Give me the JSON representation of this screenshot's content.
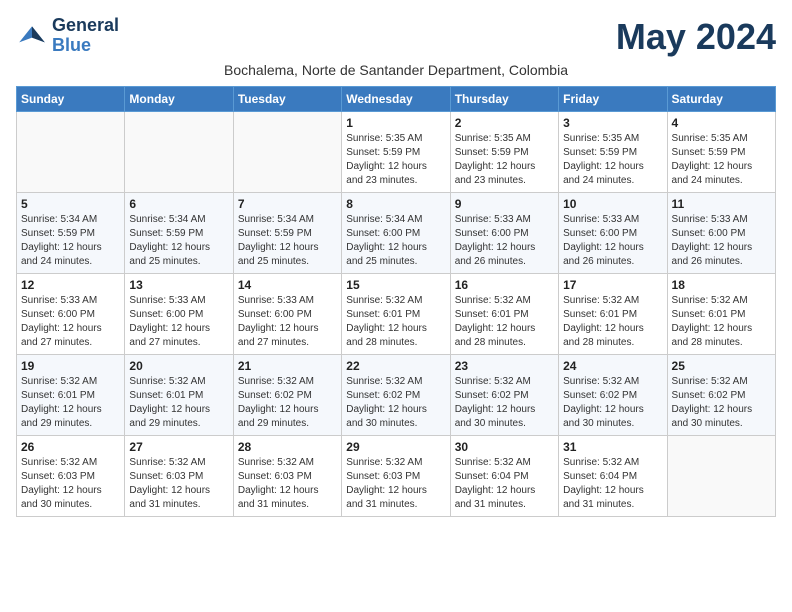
{
  "logo": {
    "line1": "General",
    "line2": "Blue"
  },
  "title": "May 2024",
  "subtitle": "Bochalema, Norte de Santander Department, Colombia",
  "days_header": [
    "Sunday",
    "Monday",
    "Tuesday",
    "Wednesday",
    "Thursday",
    "Friday",
    "Saturday"
  ],
  "weeks": [
    [
      {
        "day": "",
        "info": ""
      },
      {
        "day": "",
        "info": ""
      },
      {
        "day": "",
        "info": ""
      },
      {
        "day": "1",
        "info": "Sunrise: 5:35 AM\nSunset: 5:59 PM\nDaylight: 12 hours\nand 23 minutes."
      },
      {
        "day": "2",
        "info": "Sunrise: 5:35 AM\nSunset: 5:59 PM\nDaylight: 12 hours\nand 23 minutes."
      },
      {
        "day": "3",
        "info": "Sunrise: 5:35 AM\nSunset: 5:59 PM\nDaylight: 12 hours\nand 24 minutes."
      },
      {
        "day": "4",
        "info": "Sunrise: 5:35 AM\nSunset: 5:59 PM\nDaylight: 12 hours\nand 24 minutes."
      }
    ],
    [
      {
        "day": "5",
        "info": "Sunrise: 5:34 AM\nSunset: 5:59 PM\nDaylight: 12 hours\nand 24 minutes."
      },
      {
        "day": "6",
        "info": "Sunrise: 5:34 AM\nSunset: 5:59 PM\nDaylight: 12 hours\nand 25 minutes."
      },
      {
        "day": "7",
        "info": "Sunrise: 5:34 AM\nSunset: 5:59 PM\nDaylight: 12 hours\nand 25 minutes."
      },
      {
        "day": "8",
        "info": "Sunrise: 5:34 AM\nSunset: 6:00 PM\nDaylight: 12 hours\nand 25 minutes."
      },
      {
        "day": "9",
        "info": "Sunrise: 5:33 AM\nSunset: 6:00 PM\nDaylight: 12 hours\nand 26 minutes."
      },
      {
        "day": "10",
        "info": "Sunrise: 5:33 AM\nSunset: 6:00 PM\nDaylight: 12 hours\nand 26 minutes."
      },
      {
        "day": "11",
        "info": "Sunrise: 5:33 AM\nSunset: 6:00 PM\nDaylight: 12 hours\nand 26 minutes."
      }
    ],
    [
      {
        "day": "12",
        "info": "Sunrise: 5:33 AM\nSunset: 6:00 PM\nDaylight: 12 hours\nand 27 minutes."
      },
      {
        "day": "13",
        "info": "Sunrise: 5:33 AM\nSunset: 6:00 PM\nDaylight: 12 hours\nand 27 minutes."
      },
      {
        "day": "14",
        "info": "Sunrise: 5:33 AM\nSunset: 6:00 PM\nDaylight: 12 hours\nand 27 minutes."
      },
      {
        "day": "15",
        "info": "Sunrise: 5:32 AM\nSunset: 6:01 PM\nDaylight: 12 hours\nand 28 minutes."
      },
      {
        "day": "16",
        "info": "Sunrise: 5:32 AM\nSunset: 6:01 PM\nDaylight: 12 hours\nand 28 minutes."
      },
      {
        "day": "17",
        "info": "Sunrise: 5:32 AM\nSunset: 6:01 PM\nDaylight: 12 hours\nand 28 minutes."
      },
      {
        "day": "18",
        "info": "Sunrise: 5:32 AM\nSunset: 6:01 PM\nDaylight: 12 hours\nand 28 minutes."
      }
    ],
    [
      {
        "day": "19",
        "info": "Sunrise: 5:32 AM\nSunset: 6:01 PM\nDaylight: 12 hours\nand 29 minutes."
      },
      {
        "day": "20",
        "info": "Sunrise: 5:32 AM\nSunset: 6:01 PM\nDaylight: 12 hours\nand 29 minutes."
      },
      {
        "day": "21",
        "info": "Sunrise: 5:32 AM\nSunset: 6:02 PM\nDaylight: 12 hours\nand 29 minutes."
      },
      {
        "day": "22",
        "info": "Sunrise: 5:32 AM\nSunset: 6:02 PM\nDaylight: 12 hours\nand 30 minutes."
      },
      {
        "day": "23",
        "info": "Sunrise: 5:32 AM\nSunset: 6:02 PM\nDaylight: 12 hours\nand 30 minutes."
      },
      {
        "day": "24",
        "info": "Sunrise: 5:32 AM\nSunset: 6:02 PM\nDaylight: 12 hours\nand 30 minutes."
      },
      {
        "day": "25",
        "info": "Sunrise: 5:32 AM\nSunset: 6:02 PM\nDaylight: 12 hours\nand 30 minutes."
      }
    ],
    [
      {
        "day": "26",
        "info": "Sunrise: 5:32 AM\nSunset: 6:03 PM\nDaylight: 12 hours\nand 30 minutes."
      },
      {
        "day": "27",
        "info": "Sunrise: 5:32 AM\nSunset: 6:03 PM\nDaylight: 12 hours\nand 31 minutes."
      },
      {
        "day": "28",
        "info": "Sunrise: 5:32 AM\nSunset: 6:03 PM\nDaylight: 12 hours\nand 31 minutes."
      },
      {
        "day": "29",
        "info": "Sunrise: 5:32 AM\nSunset: 6:03 PM\nDaylight: 12 hours\nand 31 minutes."
      },
      {
        "day": "30",
        "info": "Sunrise: 5:32 AM\nSunset: 6:04 PM\nDaylight: 12 hours\nand 31 minutes."
      },
      {
        "day": "31",
        "info": "Sunrise: 5:32 AM\nSunset: 6:04 PM\nDaylight: 12 hours\nand 31 minutes."
      },
      {
        "day": "",
        "info": ""
      }
    ]
  ]
}
